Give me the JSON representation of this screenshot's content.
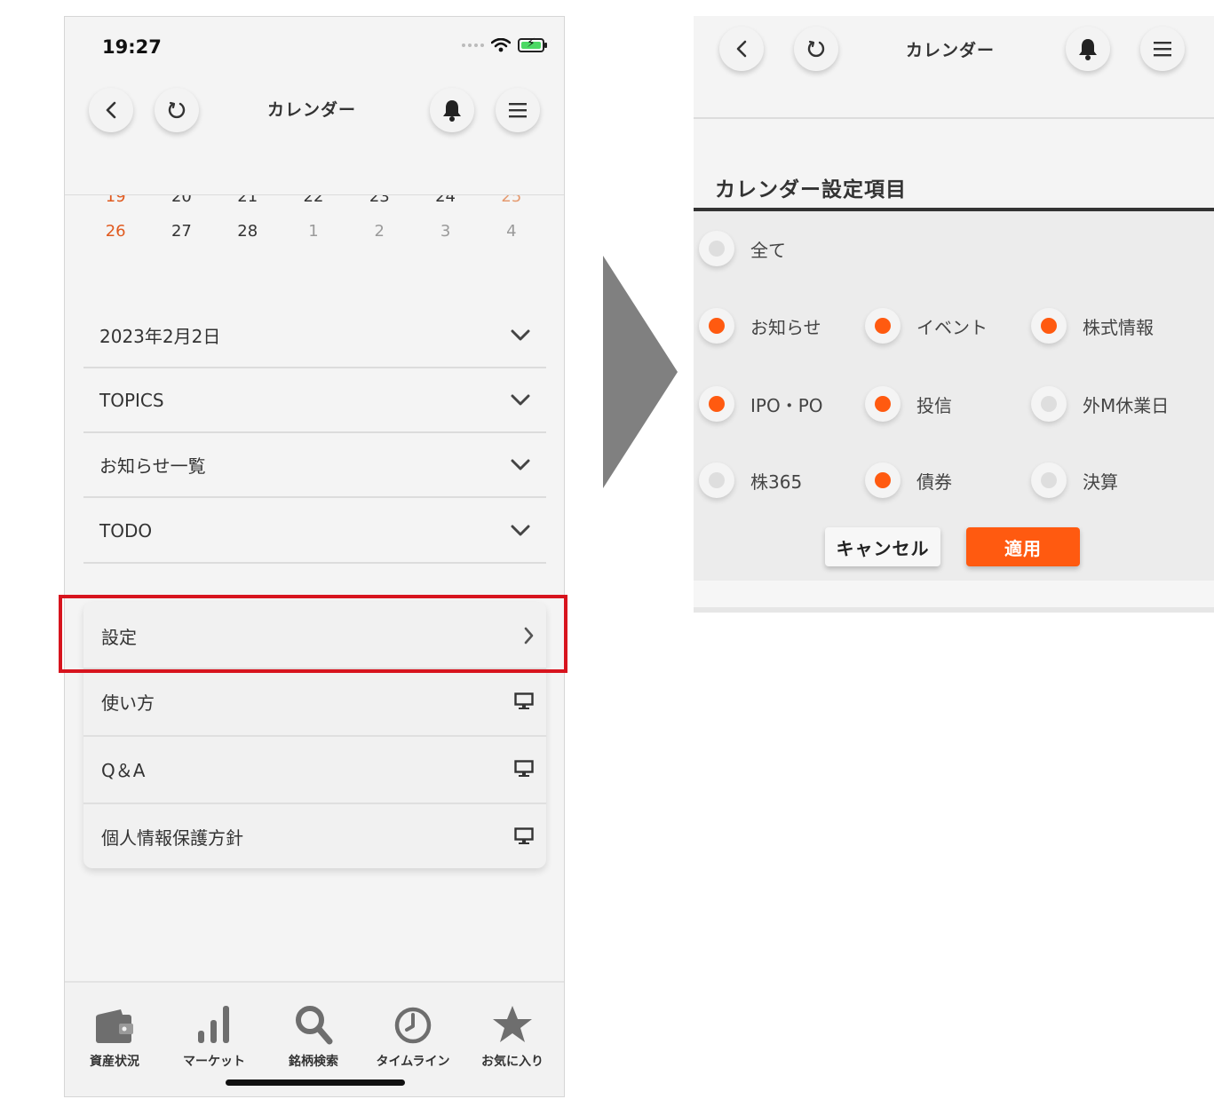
{
  "colors": {
    "accent": "#ff5a10",
    "highlight": "#d7141e",
    "sunday": "#e05a1f",
    "saturday": "#e59a6f"
  },
  "phone": {
    "status_time": "19:27",
    "header": {
      "title": "カレンダー"
    },
    "calendar": {
      "partial_row": [
        "19",
        "20",
        "21",
        "22",
        "23",
        "24",
        "25"
      ],
      "last_row": [
        "26",
        "27",
        "28",
        "1",
        "2",
        "3",
        "4"
      ]
    },
    "accordion": [
      {
        "label": "2023年2月2日"
      },
      {
        "label": "TOPICS"
      },
      {
        "label": "お知らせ一覧"
      },
      {
        "label": "TODO"
      }
    ],
    "menu": [
      {
        "label": "設定"
      },
      {
        "label": "使い方"
      },
      {
        "label": "Q＆A"
      },
      {
        "label": "個人情報保護方針"
      }
    ],
    "tabs": [
      {
        "label": "資産状況",
        "icon": "wallet-icon"
      },
      {
        "label": "マーケット",
        "icon": "bar-chart-icon"
      },
      {
        "label": "銘柄検索",
        "icon": "search-icon"
      },
      {
        "label": "タイムライン",
        "icon": "clock-icon"
      },
      {
        "label": "お気に入り",
        "icon": "star-icon"
      }
    ]
  },
  "panel": {
    "header": {
      "title": "カレンダー"
    },
    "settings_title": "カレンダー設定項目",
    "options": [
      {
        "label": "全て",
        "checked": false
      },
      {
        "label": "お知らせ",
        "checked": true
      },
      {
        "label": "イベント",
        "checked": true
      },
      {
        "label": "株式情報",
        "checked": true
      },
      {
        "label": "IPO・PO",
        "checked": true
      },
      {
        "label": "投信",
        "checked": true
      },
      {
        "label": "外M休業日",
        "checked": false
      },
      {
        "label": "株365",
        "checked": false
      },
      {
        "label": "債券",
        "checked": true
      },
      {
        "label": "決算",
        "checked": false
      }
    ],
    "cancel_label": "キャンセル",
    "apply_label": "適用"
  }
}
